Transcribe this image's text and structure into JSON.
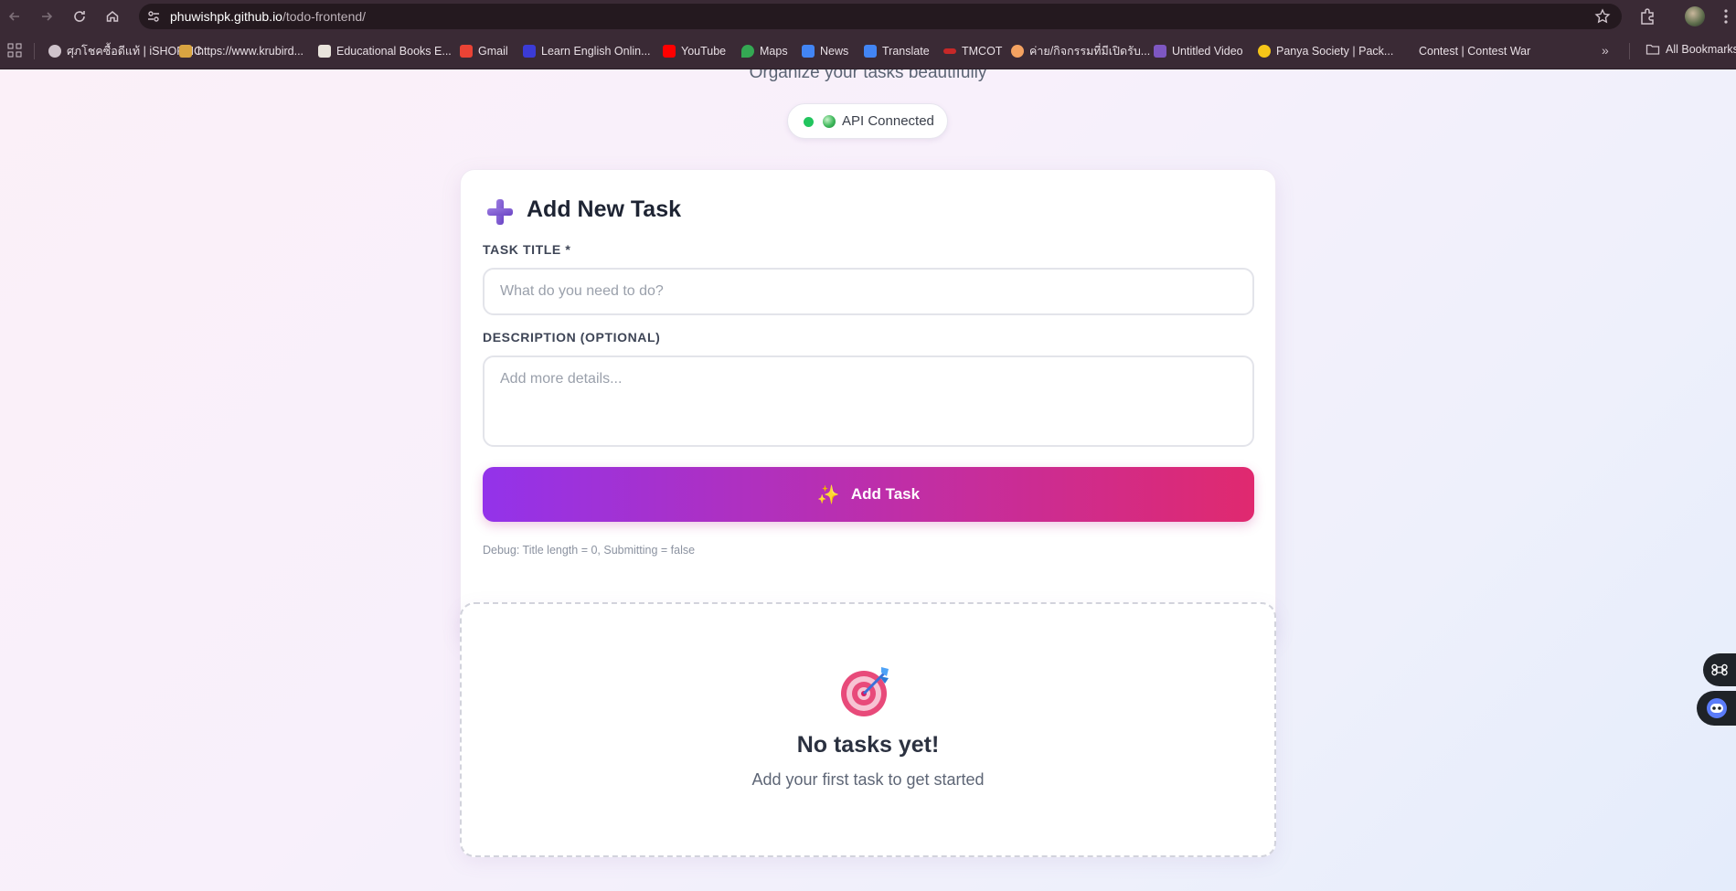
{
  "browser": {
    "url_domain": "phuwishpk.github.io",
    "url_path": "/todo-frontend/",
    "bookmarks": [
      {
        "label": "ศุภโชคซื้อดีแท้ | iSHOPMC",
        "color": "#cfc3cb"
      },
      {
        "label": "https://www.krubird...",
        "color": "#d9a441"
      },
      {
        "label": "Educational Books E...",
        "color": "#e9e4dc"
      },
      {
        "label": "Gmail",
        "color": "#ea4335"
      },
      {
        "label": "Learn English Onlin...",
        "color": "#3b3bd6"
      },
      {
        "label": "YouTube",
        "color": "#ff0000"
      },
      {
        "label": "Maps",
        "color": "#34a853"
      },
      {
        "label": "News",
        "color": "#4285f4"
      },
      {
        "label": "Translate",
        "color": "#4285f4"
      },
      {
        "label": "TMCOT",
        "color": "#c62828"
      },
      {
        "label": "ค่าย/กิจกรรมที่มีเปิดรับ...",
        "color": "#f4a261"
      },
      {
        "label": "Untitled Video",
        "color": "#7e57c2"
      },
      {
        "label": "Panya Society | Pack...",
        "color": "#f5c518"
      },
      {
        "label": "Contest | Contest War",
        "color": "#3a2a35"
      }
    ],
    "all_bookmarks_label": "All Bookmarks"
  },
  "header": {
    "subtitle": "Organize your tasks beautifully",
    "api_status": "API Connected",
    "api_status_color": "#22c55e"
  },
  "form": {
    "title": "Add New Task",
    "task_title_label": "TASK TITLE *",
    "task_title_placeholder": "What do you need to do?",
    "description_label": "DESCRIPTION (OPTIONAL)",
    "description_placeholder": "Add more details...",
    "submit_label": "Add Task",
    "debug_text": "Debug: Title length = 0, Submitting = false"
  },
  "empty_state": {
    "title": "No tasks yet!",
    "subtitle": "Add your first task to get started"
  },
  "colors": {
    "accent_start": "#9333ea",
    "accent_end": "#e0296f",
    "chrome_bg": "#3a2a35"
  }
}
